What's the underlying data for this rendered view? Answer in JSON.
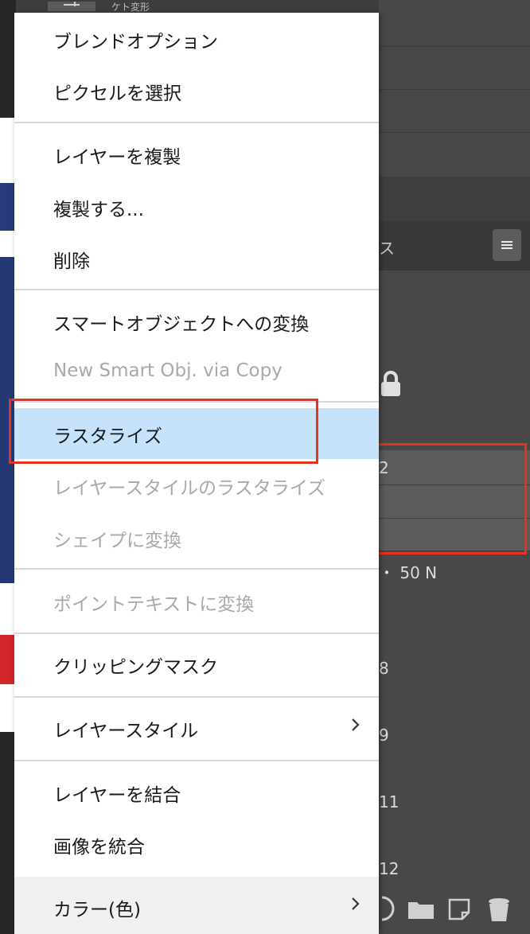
{
  "toolbar": {
    "partial_title": "ケト変形"
  },
  "layers_panel": {
    "tab_partial": "ス",
    "menu_icon": "hamburger-icon",
    "rows": [
      {
        "text": "2"
      },
      {
        "text": ""
      },
      {
        "text": ""
      },
      {
        "text": "・ 50 N"
      },
      {
        "text": "8"
      },
      {
        "text": "9"
      },
      {
        "text": "11"
      },
      {
        "text": "12"
      }
    ],
    "bottom_icons": [
      "adjustment-icon",
      "folder-icon",
      "new-layer-icon",
      "trash-icon"
    ]
  },
  "context_menu": {
    "items": [
      {
        "label": "ブレンドオプション",
        "enabled": true
      },
      {
        "label": "ピクセルを選択",
        "enabled": true
      },
      {
        "label": "レイヤーを複製",
        "enabled": true
      },
      {
        "label": "複製する...",
        "enabled": true
      },
      {
        "label": "削除",
        "enabled": true
      },
      {
        "label": "スマートオブジェクトへの変換",
        "enabled": true
      },
      {
        "label": "New Smart Obj. via Copy",
        "enabled": false
      },
      {
        "label": "ラスタライズ",
        "enabled": true,
        "highlighted": true
      },
      {
        "label": "レイヤースタイルのラスタライズ",
        "enabled": false
      },
      {
        "label": "シェイプに変換",
        "enabled": false
      },
      {
        "label": "ポイントテキストに変換",
        "enabled": false
      },
      {
        "label": "クリッピングマスク",
        "enabled": true
      },
      {
        "label": "レイヤースタイル",
        "enabled": true,
        "submenu": true
      },
      {
        "label": "レイヤーを結合",
        "enabled": true
      },
      {
        "label": "画像を統合",
        "enabled": true
      },
      {
        "label": "カラー(色)",
        "enabled": true,
        "submenu": true
      }
    ]
  },
  "colors": {
    "menu_highlight": "#c6e3fb",
    "annotation_red": "#e8321b",
    "panel_bg": "#484848"
  }
}
